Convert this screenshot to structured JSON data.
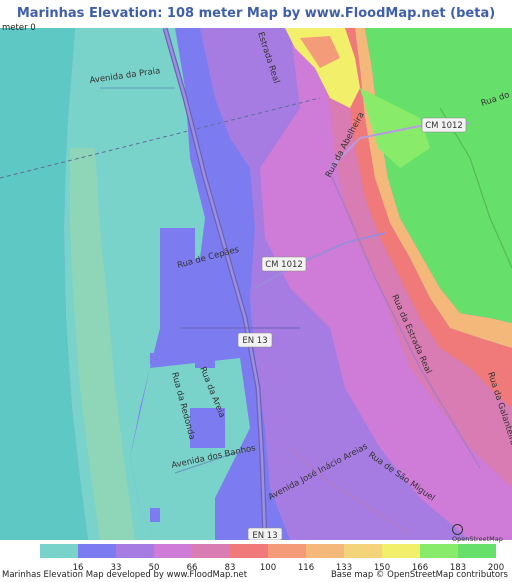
{
  "title": "Marinhas Elevation: 108 meter Map by www.FloodMap.net (beta)",
  "map": {
    "streets": {
      "avenida_da_praia": "Avenida da Praia",
      "estrada_real": "Estrada Real",
      "rua_da_abelheira": "Rua da Abelheira",
      "cm1012_top": "CM 1012",
      "rua_do": "Rua do",
      "rua_de_cepaes": "Rua de Cepães",
      "cm1012_mid": "CM 1012",
      "en13_mid": "EN 13",
      "rua_da_estrada_real": "Rua da Estrada Real",
      "rua_da_areia": "Rua da Areia",
      "rua_da_redonda": "Rua da Redonda",
      "avenida_dos_banhos": "Avenida dos Banhos",
      "avenida_jose_inacio_areias": "Avenida José Inácio Areias",
      "rua_de_sao_miguel": "Rua de São Miguel",
      "rua_da_galanteira": "Rua da Galanteira",
      "en13_bottom": "EN 13"
    },
    "osm_badge": "OpenStreetMap"
  },
  "legend": {
    "title": "meter 0",
    "ticks": [
      "16",
      "33",
      "50",
      "66",
      "83",
      "100",
      "116",
      "133",
      "150",
      "166",
      "183",
      "200"
    ],
    "colors": [
      "#7ad3cb",
      "#7c7cf0",
      "#a77ce2",
      "#cf7cd8",
      "#d97cb4",
      "#f07a7a",
      "#f49c7a",
      "#f4b87a",
      "#f4d47a",
      "#f2f06a",
      "#88ec6a",
      "#66e06a"
    ]
  },
  "footer": {
    "left": "Marinhas Elevation Map developed by www.FloodMap.net",
    "right": "Base map © OpenStreetMap contributors"
  }
}
